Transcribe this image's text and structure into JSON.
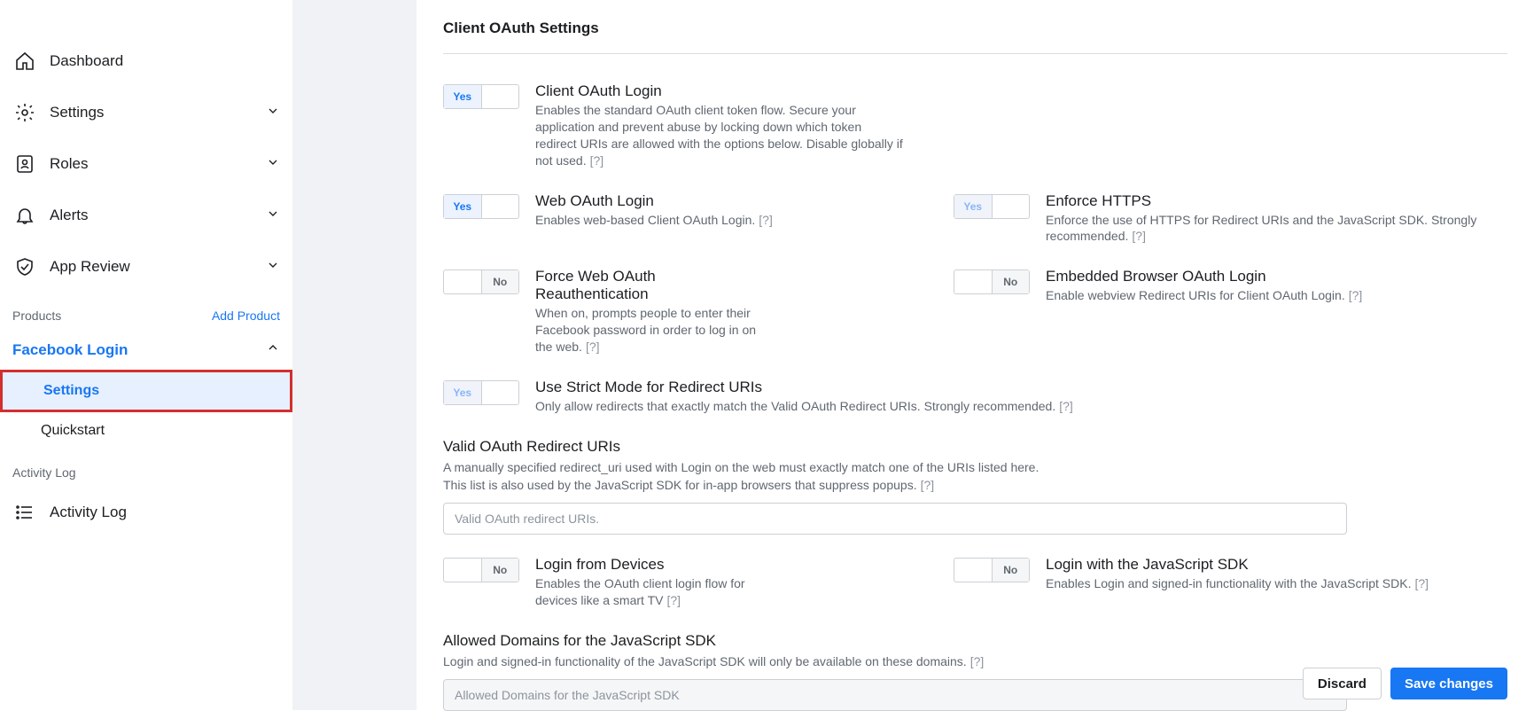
{
  "sidebar": {
    "dashboard": "Dashboard",
    "settings": "Settings",
    "roles": "Roles",
    "alerts": "Alerts",
    "app_review": "App Review",
    "products_label": "Products",
    "add_product": "Add Product",
    "facebook_login": "Facebook Login",
    "fb_settings": "Settings",
    "fb_quickstart": "Quickstart",
    "activity_log_label": "Activity Log",
    "activity_log": "Activity Log"
  },
  "main": {
    "title": "Client OAuth Settings",
    "yes": "Yes",
    "no": "No",
    "help": "[?]",
    "client_oauth": {
      "title": "Client OAuth Login",
      "desc": "Enables the standard OAuth client token flow. Secure your application and prevent abuse by locking down which token redirect URIs are allowed with the options below. Disable globally if not used."
    },
    "web_oauth": {
      "title": "Web OAuth Login",
      "desc": "Enables web-based Client OAuth Login."
    },
    "enforce_https": {
      "title": "Enforce HTTPS",
      "desc": "Enforce the use of HTTPS for Redirect URIs and the JavaScript SDK. Strongly recommended."
    },
    "force_reauth": {
      "title": "Force Web OAuth Reauthentication",
      "desc": "When on, prompts people to enter their Facebook password in order to log in on the web."
    },
    "embedded": {
      "title": "Embedded Browser OAuth Login",
      "desc": "Enable webview Redirect URIs for Client OAuth Login."
    },
    "strict": {
      "title": "Use Strict Mode for Redirect URIs",
      "desc": "Only allow redirects that exactly match the Valid OAuth Redirect URIs. Strongly recommended."
    },
    "redirect_uris": {
      "title": "Valid OAuth Redirect URIs",
      "desc1": "A manually specified redirect_uri used with Login on the web must exactly match one of the URIs listed here.",
      "desc2": "This list is also used by the JavaScript SDK for in-app browsers that suppress popups.",
      "placeholder": "Valid OAuth redirect URIs."
    },
    "login_devices": {
      "title": "Login from Devices",
      "desc": "Enables the OAuth client login flow for devices like a smart TV"
    },
    "login_js": {
      "title": "Login with the JavaScript SDK",
      "desc": "Enables Login and signed-in functionality with the JavaScript SDK."
    },
    "allowed_domains": {
      "title": "Allowed Domains for the JavaScript SDK",
      "desc": "Login and signed-in functionality of the JavaScript SDK will only be available on these domains.",
      "placeholder": "Allowed Domains for the JavaScript SDK"
    },
    "footer": {
      "discard": "Discard",
      "save": "Save changes"
    }
  }
}
